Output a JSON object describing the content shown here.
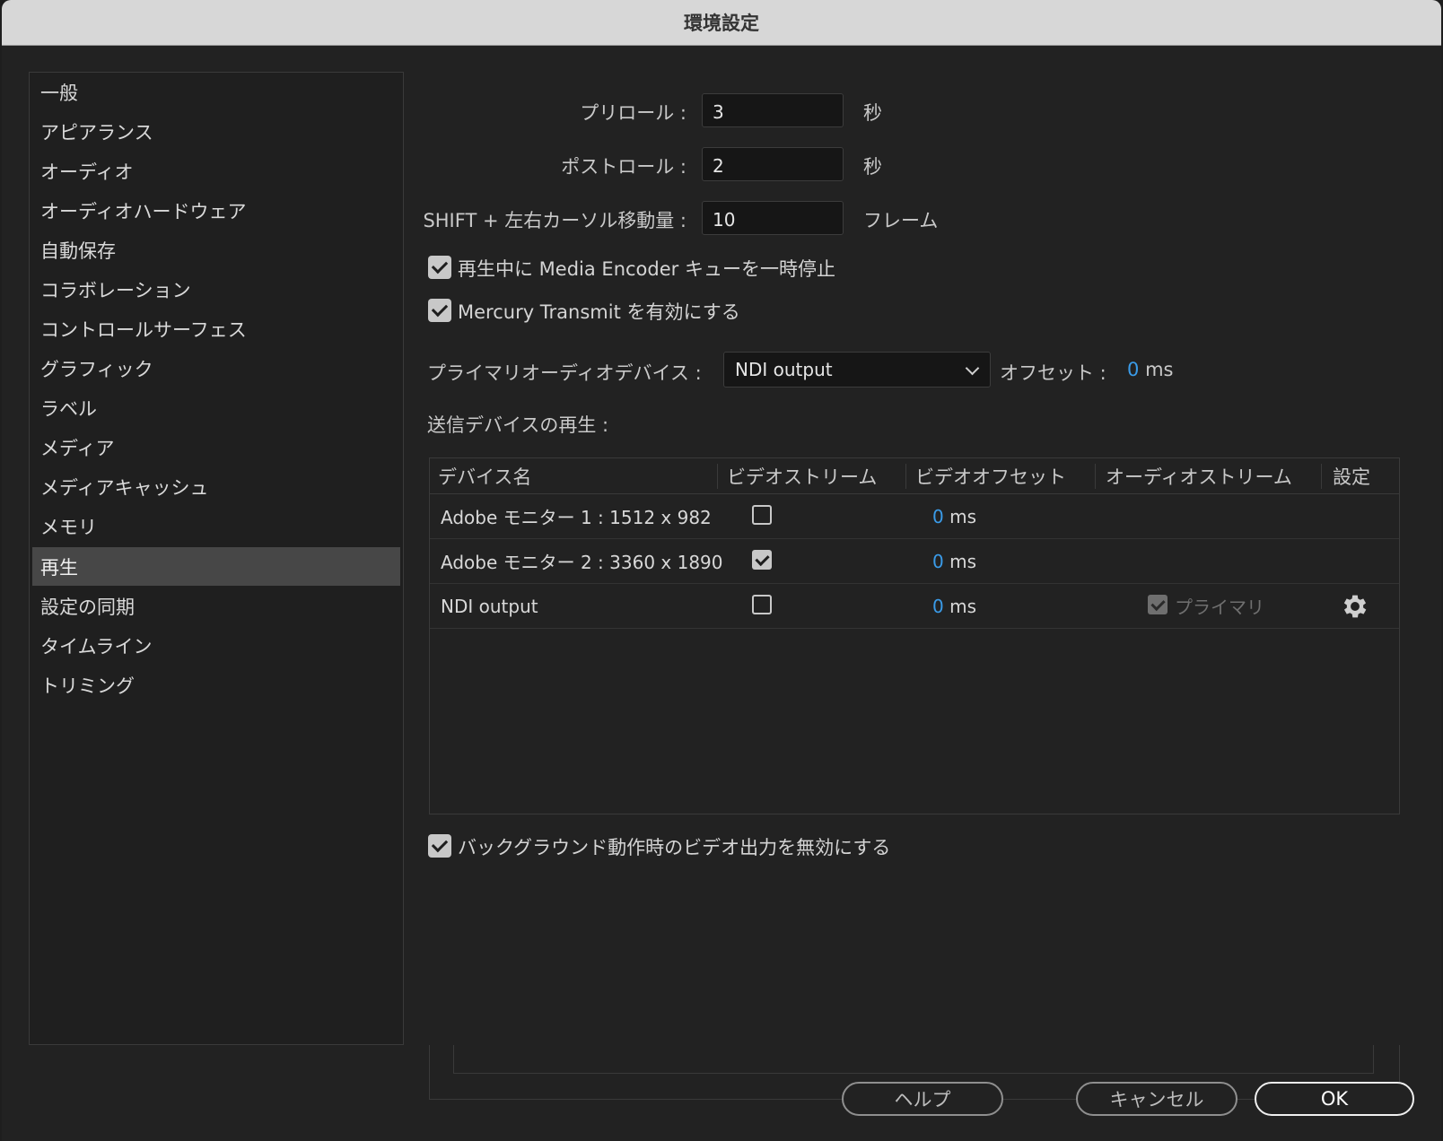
{
  "window": {
    "title": "環境設定"
  },
  "sidebar": {
    "items": [
      {
        "label": "一般"
      },
      {
        "label": "アピアランス"
      },
      {
        "label": "オーディオ"
      },
      {
        "label": "オーディオハードウェア"
      },
      {
        "label": "自動保存"
      },
      {
        "label": "コラボレーション"
      },
      {
        "label": "コントロールサーフェス"
      },
      {
        "label": "グラフィック"
      },
      {
        "label": "ラベル"
      },
      {
        "label": "メディア"
      },
      {
        "label": "メディアキャッシュ"
      },
      {
        "label": "メモリ"
      },
      {
        "label": "再生",
        "selected": true
      },
      {
        "label": "設定の同期"
      },
      {
        "label": "タイムライン"
      },
      {
        "label": "トリミング"
      }
    ]
  },
  "playback": {
    "preroll": {
      "label": "プリロール :",
      "value": "3",
      "unit": "秒"
    },
    "postroll": {
      "label": "ポストロール :",
      "value": "2",
      "unit": "秒"
    },
    "shift_step": {
      "label": "SHIFT + 左右カーソル移動量 :",
      "value": "10",
      "unit": "フレーム"
    },
    "pause_encoder": {
      "label": "再生中に Media Encoder キューを一時停止",
      "checked": true
    },
    "mercury": {
      "label": "Mercury Transmit を有効にする",
      "checked": true
    },
    "primary_audio": {
      "label": "プライマリオーディオデバイス :",
      "selected": "NDI output",
      "offset_label": "オフセット :",
      "offset_value": "0",
      "offset_unit": "ms"
    },
    "transmit_label": "送信デバイスの再生 :",
    "table": {
      "headers": [
        "デバイス名",
        "ビデオストリーム",
        "ビデオオフセット",
        "オーディオストリーム",
        "設定"
      ],
      "rows": [
        {
          "name": "Adobe モニター 1 : 1512 x 982",
          "video": false,
          "offset": "0",
          "unit": "ms"
        },
        {
          "name": "Adobe モニター 2 : 3360 x 1890",
          "video": true,
          "offset": "0",
          "unit": "ms"
        },
        {
          "name": "NDI output",
          "video": false,
          "offset": "0",
          "unit": "ms",
          "audio_label": "プライマリ",
          "audio_checked": true
        }
      ]
    },
    "disable_bg": {
      "label": "バックグラウンド動作時のビデオ出力を無効にする",
      "checked": true
    }
  },
  "buttons": {
    "help": "ヘルプ",
    "cancel": "キャンセル",
    "ok": "OK"
  },
  "colors": {
    "accent_blue": "#3a9be8",
    "selected_bg": "#474747"
  }
}
